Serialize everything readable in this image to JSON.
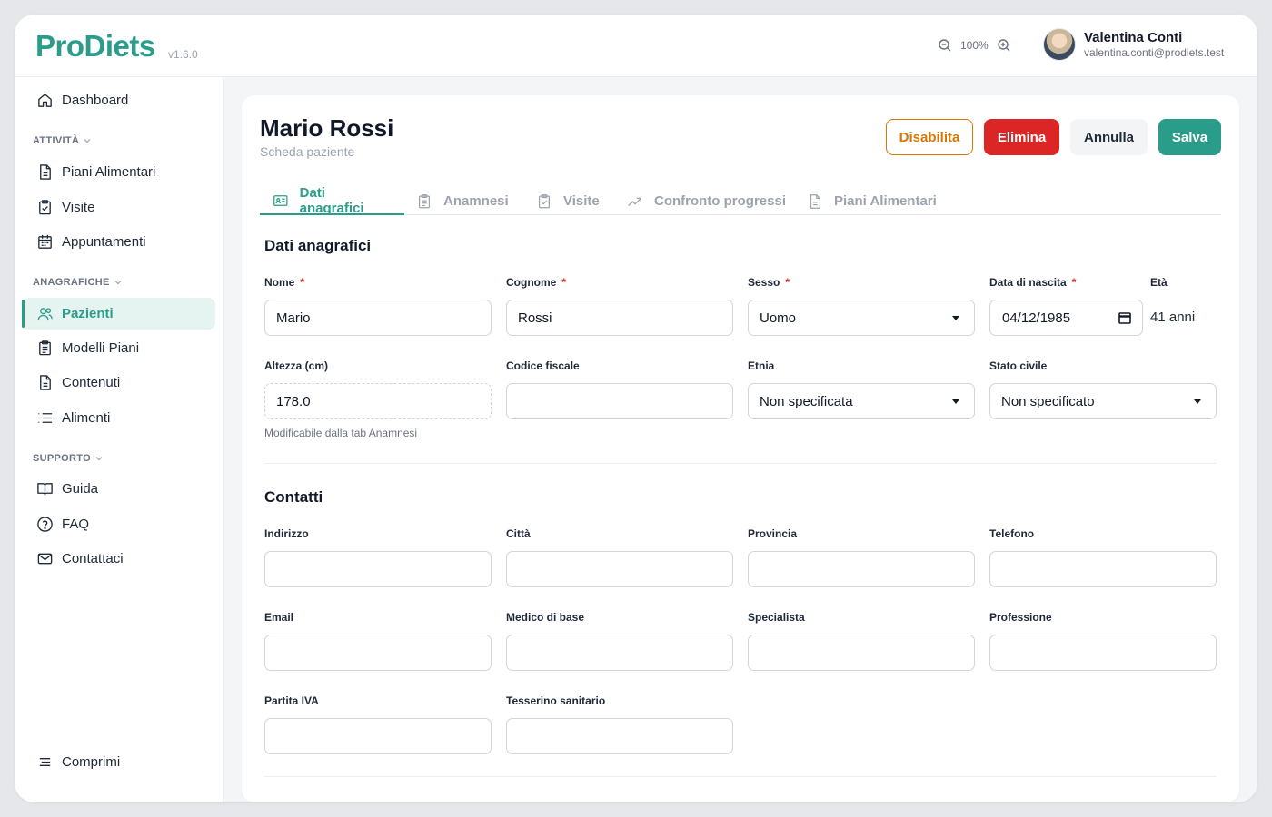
{
  "app": {
    "name": "ProDiets",
    "version": "v1.6.0"
  },
  "header": {
    "zoom_level": "100%",
    "user": {
      "name": "Valentina Conti",
      "email": "valentina.conti@prodiets.test"
    }
  },
  "sidebar": {
    "dashboard": "Dashboard",
    "sections": [
      {
        "label": "ATTIVITÀ",
        "items": [
          "Piani Alimentari",
          "Visite",
          "Appuntamenti"
        ]
      },
      {
        "label": "ANAGRAFICHE",
        "items": [
          "Pazienti",
          "Modelli Piani",
          "Contenuti",
          "Alimenti"
        ]
      },
      {
        "label": "SUPPORTO",
        "items": [
          "Guida",
          "FAQ",
          "Contattaci"
        ]
      }
    ],
    "collapse": "Comprimi"
  },
  "page": {
    "title": "Mario Rossi",
    "subtitle": "Scheda paziente",
    "buttons": {
      "disable": "Disabilita",
      "delete": "Elimina",
      "cancel": "Annulla",
      "save": "Salva"
    },
    "tabs": [
      "Dati anagrafici",
      "Anamnesi",
      "Visite",
      "Confronto progressi",
      "Piani Alimentari"
    ],
    "active_tab": "Dati anagrafici"
  },
  "personal": {
    "title": "Dati anagrafici",
    "first_name": {
      "label": "Nome",
      "value": "Mario"
    },
    "last_name": {
      "label": "Cognome",
      "value": "Rossi"
    },
    "sex": {
      "label": "Sesso",
      "value": "Uomo"
    },
    "birth_date": {
      "label": "Data di nascita",
      "value": "04/12/1985"
    },
    "age": {
      "label": "Età",
      "value": "41 anni"
    },
    "height": {
      "label": "Altezza (cm)",
      "value": "178.0",
      "hint": "Modificabile dalla tab Anamnesi"
    },
    "tax_code": {
      "label": "Codice fiscale",
      "value": ""
    },
    "ethnicity": {
      "label": "Etnia",
      "value": "Non specificata"
    },
    "marital": {
      "label": "Stato civile",
      "value": "Non specificato"
    }
  },
  "contacts": {
    "title": "Contatti",
    "address": {
      "label": "Indirizzo",
      "value": ""
    },
    "city": {
      "label": "Città",
      "value": ""
    },
    "province": {
      "label": "Provincia",
      "value": ""
    },
    "phone": {
      "label": "Telefono",
      "value": ""
    },
    "email": {
      "label": "Email",
      "value": ""
    },
    "gp": {
      "label": "Medico di base",
      "value": ""
    },
    "specialist": {
      "label": "Specialista",
      "value": ""
    },
    "profession": {
      "label": "Professione",
      "value": ""
    },
    "vat": {
      "label": "Partita IVA",
      "value": ""
    },
    "health_card": {
      "label": "Tesserino sanitario",
      "value": ""
    }
  },
  "colors": {
    "brand": "#2a9d8a",
    "danger": "#dc2626",
    "warning": "#d97706"
  },
  "icons": {
    "dashboard": "home-icon",
    "plans": "document-icon",
    "visits": "clipboard-icon",
    "appointments": "calendar-icon",
    "patients": "users-icon",
    "templates": "clipboard-list-icon",
    "contents": "document-icon",
    "foods": "list-icon",
    "guide": "book-icon",
    "faq": "help-circle-icon",
    "contact": "mail-icon",
    "collapse": "menu-icon"
  }
}
